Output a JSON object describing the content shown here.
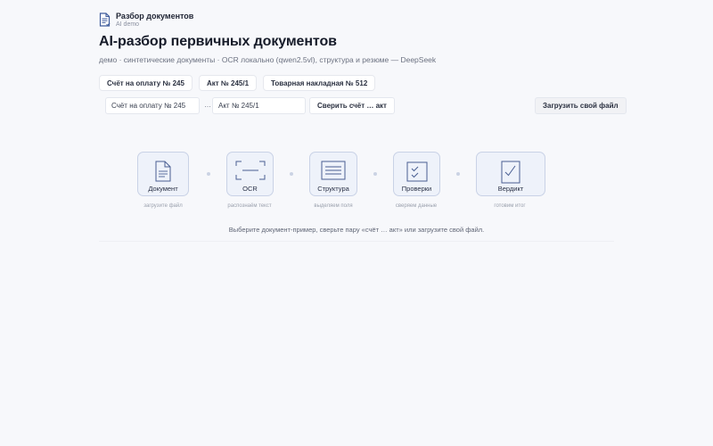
{
  "brand": {
    "title": "Разбор документов",
    "subtitle": "AI demo"
  },
  "header": {
    "title": "AI-разбор первичных документов",
    "subtitle": "демо · синтетические документы · OCR локально (qwen2.5vl), структура и резюме — DeepSeek"
  },
  "samples": [
    {
      "label": "Счёт на оплату № 245"
    },
    {
      "label": "Акт № 245/1"
    },
    {
      "label": "Товарная накладная № 512"
    }
  ],
  "compare": {
    "field_a": "Счёт на оплату № 245",
    "separator": "…",
    "field_b": "Акт № 245/1",
    "compare_label": "Сверить счёт … акт",
    "upload_label": "Загрузить свой файл"
  },
  "pipeline": [
    {
      "label": "Документ",
      "caption": "загрузите файл",
      "icon": "document-icon"
    },
    {
      "label": "OCR",
      "caption": "распознаём текст",
      "icon": "scan-icon"
    },
    {
      "label": "Структура",
      "caption": "выделяем поля",
      "icon": "structure-icon"
    },
    {
      "label": "Проверки",
      "caption": "сверяем данные",
      "icon": "checklist-icon"
    },
    {
      "label": "Вердикт",
      "caption": "готовим итог",
      "icon": "verdict-icon"
    }
  ],
  "hint": "Выберите документ-пример, сверьте пару «счёт … акт» или загрузите свой файл.",
  "colors": {
    "accent": "#3f5c9c",
    "step_bg": "#eef2fa",
    "step_border": "#c9d2e6"
  }
}
